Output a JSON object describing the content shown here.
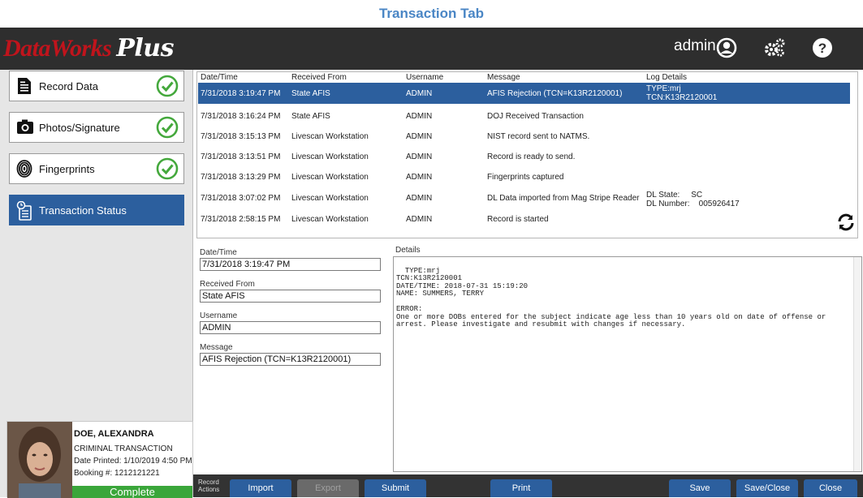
{
  "page_title": "Transaction Tab",
  "header": {
    "logo_part1": "DataWorks",
    "logo_part2": "Plus",
    "user": "admin",
    "icons": [
      "user-circle-icon",
      "gears-icon",
      "help-icon"
    ],
    "bg_color": "#2e2e2e"
  },
  "sidebar": {
    "items": [
      {
        "label": "Record Data",
        "icon": "document-icon",
        "status": "complete"
      },
      {
        "label": "Photos/Signature",
        "icon": "camera-icon",
        "status": "complete"
      },
      {
        "label": "Fingerprints",
        "icon": "fingerprint-icon",
        "status": "complete"
      },
      {
        "label": "Transaction Status",
        "icon": "transaction-status-icon",
        "status": "active"
      }
    ]
  },
  "subject": {
    "name": "DOE,  ALEXANDRA",
    "type": "CRIMINAL TRANSACTION",
    "date_printed": "Date Printed: 1/10/2019 4:50 PM",
    "booking": "Booking #:  1212121221",
    "status": "Complete"
  },
  "grid": {
    "headers": [
      "Date/Time",
      "Received From",
      "Username",
      "Message",
      "Log Details"
    ],
    "rows": [
      {
        "datetime": "7/31/2018 3:19:47 PM",
        "received_from": "State AFIS",
        "username": "ADMIN",
        "message": "AFIS Rejection (TCN=K13R2120001)",
        "log_line1": "TYPE:mrj",
        "log_line2": "TCN:K13R2120001"
      },
      {
        "datetime": "7/31/2018 3:16:24 PM",
        "received_from": "State AFIS",
        "username": "ADMIN",
        "message": "DOJ Received Transaction",
        "log_line1": "",
        "log_line2": ""
      },
      {
        "datetime": "7/31/2018 3:15:13 PM",
        "received_from": "Livescan Workstation",
        "username": "ADMIN",
        "message": "NIST record sent to NATMS.",
        "log_line1": "",
        "log_line2": ""
      },
      {
        "datetime": "7/31/2018 3:13:51 PM",
        "received_from": "Livescan Workstation",
        "username": "ADMIN",
        "message": "Record is ready to send.",
        "log_line1": "",
        "log_line2": ""
      },
      {
        "datetime": "7/31/2018 3:13:29 PM",
        "received_from": "Livescan Workstation",
        "username": "ADMIN",
        "message": "Fingerprints captured",
        "log_line1": "",
        "log_line2": ""
      },
      {
        "datetime": "7/31/2018 3:07:02 PM",
        "received_from": "Livescan Workstation",
        "username": "ADMIN",
        "message": "DL Data imported from Mag Stripe Reader",
        "log_line1": "DL State:     SC",
        "log_line2": "DL Number:    005926417"
      },
      {
        "datetime": "7/31/2018 2:58:15 PM",
        "received_from": "Livescan Workstation",
        "username": "ADMIN",
        "message": "Record is started",
        "log_line1": "",
        "log_line2": ""
      }
    ],
    "selected_color": "#2c5f9e"
  },
  "detail_form": {
    "datetime_label": "Date/Time",
    "datetime_value": "7/31/2018 3:19:47 PM",
    "received_label": "Received From",
    "received_value": "State AFIS",
    "username_label": "Username",
    "username_value": "ADMIN",
    "message_label": "Message",
    "message_value": "AFIS Rejection (TCN=K13R2120001)"
  },
  "details": {
    "label": "Details",
    "text": "TYPE:mrj\nTCN:K13R2120001\nDATE/TIME: 2018-07-31 15:19:20\nNAME: SUMMERS, TERRY\n\nERROR:\nOne or more DOBs entered for the subject indicate age less than 10 years old on date of offense or\narrest. Please investigate and resubmit with changes if necessary."
  },
  "actions": {
    "label_line1": "Record",
    "label_line2": "Actions",
    "import": "Import",
    "export": "Export",
    "submit": "Submit",
    "print": "Print",
    "save": "Save",
    "save_close": "Save/Close",
    "close": "Close"
  }
}
